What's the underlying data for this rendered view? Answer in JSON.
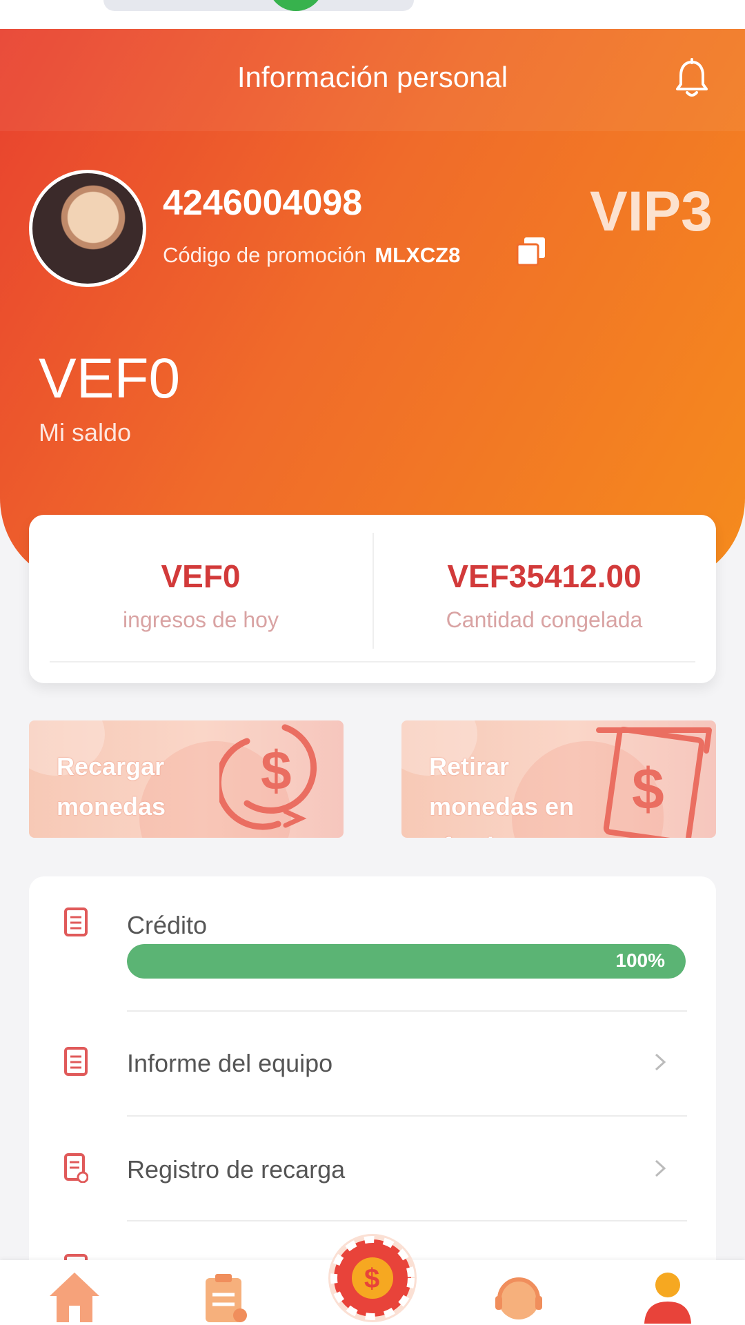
{
  "header": {
    "title": "Información personal",
    "notification_icon": "bell-icon"
  },
  "profile": {
    "user_id": "4246004098",
    "promo_label": "Código de promoción",
    "promo_code": "MLXCZ8",
    "vip_level": "VIP3",
    "balance": "VEF0",
    "balance_label": "Mi saldo"
  },
  "stats": [
    {
      "value": "VEF0",
      "label": "ingresos de hoy"
    },
    {
      "value": "VEF35412.00",
      "label": "Cantidad congelada"
    }
  ],
  "actions": [
    {
      "label": "Recargar monedas",
      "icon": "dollar-refresh-icon"
    },
    {
      "label": "Retirar monedas en efectivo",
      "icon": "dollar-bill-icon"
    }
  ],
  "menu": {
    "credit_label": "Crédito",
    "credit_progress": 100,
    "credit_progress_text": "100%",
    "items": [
      {
        "label": "Informe del equipo",
        "icon": "document-icon"
      },
      {
        "label": "Registro de recarga",
        "icon": "receipt-icon"
      }
    ]
  },
  "bottom_nav": [
    {
      "name": "home",
      "icon": "home-icon"
    },
    {
      "name": "orders",
      "icon": "clipboard-icon"
    },
    {
      "name": "center",
      "icon": "coin-wheel-icon"
    },
    {
      "name": "support",
      "icon": "headset-icon"
    },
    {
      "name": "profile",
      "icon": "user-icon"
    }
  ],
  "colors": {
    "accent": "#f06b2a",
    "value_red": "#d23a3a",
    "progress_green": "#5bb474"
  }
}
